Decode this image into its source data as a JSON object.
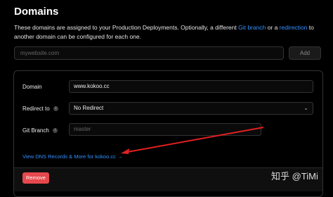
{
  "page": {
    "title": "Domains"
  },
  "description": {
    "part1": "These domains are assigned to your Production Deployments. Optionally, a different ",
    "git_branch_link": "Git branch",
    "part2": " or a ",
    "redirection_link": "redirection",
    "part3": " to another domain can be configured for each one."
  },
  "add_domain": {
    "placeholder": "mywebsite.com",
    "button_label": "Add"
  },
  "domain_card": {
    "domain_label": "Domain",
    "domain_value": "www.kokoo.cc",
    "redirect_label": "Redirect to",
    "redirect_value": "No Redirect",
    "git_branch_label": "Git Branch",
    "git_branch_placeholder": "master",
    "dns_link": "View DNS Records & More for kokoo.cc →",
    "remove_label": "Remove"
  },
  "icons": {
    "info": "info-icon",
    "chevron": "chevron-down-icon"
  },
  "annotation": {
    "color": "#e02020"
  },
  "watermark": "知乎 @TiMi",
  "colors": {
    "link": "#3291ff",
    "danger": "#e5484d",
    "background": "#000000"
  }
}
